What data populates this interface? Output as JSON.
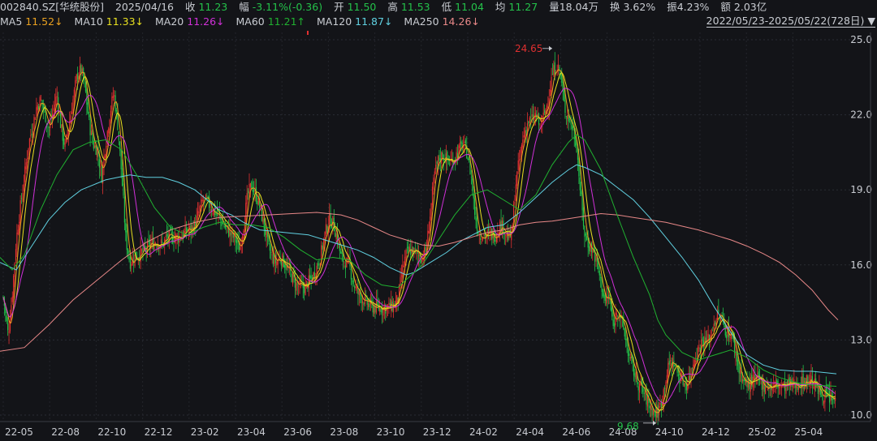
{
  "header": {
    "code": "002840.SZ[华统股份]",
    "date": "2025/04/16",
    "close_label": "收",
    "close": "11.23",
    "chg_label": "幅",
    "chg": "-3.11%(-0.36)",
    "open_label": "开",
    "open": "11.50",
    "high_label": "高",
    "high": "11.53",
    "low_label": "低",
    "low": "11.04",
    "avg_label": "均",
    "avg": "11.27",
    "vol_label": "量",
    "vol": "18.04万",
    "turn_label": "换",
    "turn": "3.62%",
    "amp_label": "振",
    "amp": "4.23%",
    "amt_label": "额",
    "amt": "2.03亿"
  },
  "ma_legend": [
    {
      "name": "MA5",
      "value": "11.52↓",
      "color": "#e8a020"
    },
    {
      "name": "MA10",
      "value": "11.33↓",
      "color": "#e8e020"
    },
    {
      "name": "MA20",
      "value": "11.26↓",
      "color": "#d030d8"
    },
    {
      "name": "MA60",
      "value": "11.21↑",
      "color": "#20b030"
    },
    {
      "name": "MA120",
      "value": "11.87↓",
      "color": "#60d0e0"
    },
    {
      "name": "MA250",
      "value": "14.26↓",
      "color": "#e88888"
    }
  ],
  "range_label": "2022/05/23-2025/05/22(728日)",
  "chart_data": {
    "type": "candlestick",
    "ylim": [
      9.5,
      25.1
    ],
    "y_ticks": [
      "25.0",
      "22.0",
      "19.0",
      "16.0",
      "13.0",
      "10.0"
    ],
    "x_ticks": [
      "22-05",
      "22-08",
      "22-10",
      "22-12",
      "23-02",
      "23-04",
      "23-06",
      "23-08",
      "23-10",
      "23-12",
      "24-02",
      "24-04",
      "24-06",
      "24-08",
      "24-10",
      "24-12",
      "25-02",
      "25-04"
    ],
    "annotations": [
      {
        "label": "24.65",
        "value": 24.65,
        "kind": "high",
        "color": "#e03030"
      },
      {
        "label": "9.68",
        "value": 9.68,
        "kind": "low",
        "color": "#24c24a"
      }
    ],
    "price_path": [
      [
        0,
        15.6
      ],
      [
        5,
        14.5
      ],
      [
        10,
        13.2
      ],
      [
        15,
        14.8
      ],
      [
        20,
        17
      ],
      [
        25,
        18.3
      ],
      [
        30,
        19.5
      ],
      [
        35,
        20.8
      ],
      [
        40,
        21.5
      ],
      [
        45,
        22.3
      ],
      [
        50,
        22.6
      ],
      [
        55,
        22.1
      ],
      [
        60,
        21.4
      ],
      [
        65,
        22.1
      ],
      [
        70,
        22.8
      ],
      [
        75,
        21.5
      ],
      [
        80,
        20.7
      ],
      [
        85,
        21.6
      ],
      [
        90,
        22.6
      ],
      [
        95,
        23.6
      ],
      [
        100,
        23.8
      ],
      [
        105,
        23
      ],
      [
        110,
        21.6
      ],
      [
        115,
        20.8
      ],
      [
        120,
        20.6
      ],
      [
        125,
        19.5
      ],
      [
        130,
        20.8
      ],
      [
        135,
        22
      ],
      [
        140,
        22.9
      ],
      [
        145,
        21.6
      ],
      [
        150,
        19.5
      ],
      [
        155,
        17
      ],
      [
        160,
        16.1
      ],
      [
        165,
        16.3
      ],
      [
        170,
        16.4
      ],
      [
        175,
        16.5
      ],
      [
        180,
        16.6
      ],
      [
        185,
        16.8
      ],
      [
        190,
        16.9
      ],
      [
        195,
        16.9
      ],
      [
        200,
        16.8
      ],
      [
        205,
        17.1
      ],
      [
        210,
        17.1
      ],
      [
        215,
        17.1
      ],
      [
        220,
        17.1
      ],
      [
        225,
        17.2
      ],
      [
        230,
        17.4
      ],
      [
        235,
        17.4
      ],
      [
        240,
        17.6
      ],
      [
        245,
        18.1
      ],
      [
        250,
        18.6
      ],
      [
        255,
        18.5
      ],
      [
        260,
        18.3
      ],
      [
        265,
        18.1
      ],
      [
        270,
        17.9
      ],
      [
        275,
        17.6
      ],
      [
        280,
        17.4
      ],
      [
        285,
        17.2
      ],
      [
        290,
        17
      ],
      [
        295,
        16.6
      ],
      [
        300,
        17.6
      ],
      [
        305,
        18.8
      ],
      [
        310,
        19.2
      ],
      [
        315,
        18.8
      ],
      [
        320,
        18.3
      ],
      [
        325,
        17.6
      ],
      [
        330,
        16.8
      ],
      [
        335,
        16.3
      ],
      [
        340,
        16.1
      ],
      [
        345,
        16.3
      ],
      [
        350,
        16.1
      ],
      [
        355,
        15.8
      ],
      [
        360,
        15.5
      ],
      [
        365,
        15.2
      ],
      [
        370,
        15.1
      ],
      [
        375,
        15.1
      ],
      [
        380,
        15.3
      ],
      [
        385,
        15.5
      ],
      [
        390,
        15.9
      ],
      [
        395,
        16.4
      ],
      [
        400,
        17.2
      ],
      [
        405,
        17.8
      ],
      [
        410,
        17.7
      ],
      [
        415,
        17.1
      ],
      [
        420,
        16.3
      ],
      [
        425,
        16.1
      ],
      [
        430,
        16
      ],
      [
        435,
        15.3
      ],
      [
        440,
        14.9
      ],
      [
        445,
        14.7
      ],
      [
        450,
        14.5
      ],
      [
        455,
        14.4
      ],
      [
        460,
        14.3
      ],
      [
        465,
        14.3
      ],
      [
        470,
        14.3
      ],
      [
        475,
        14.3
      ],
      [
        480,
        14.3
      ],
      [
        485,
        14.4
      ],
      [
        490,
        14.6
      ],
      [
        495,
        15.7
      ],
      [
        500,
        16.4
      ],
      [
        505,
        16.6
      ],
      [
        510,
        16.5
      ],
      [
        515,
        16.4
      ],
      [
        520,
        16.3
      ],
      [
        525,
        16.6
      ],
      [
        530,
        18.1
      ],
      [
        535,
        19.6
      ],
      [
        540,
        20.2
      ],
      [
        545,
        20.4
      ],
      [
        550,
        20.2
      ],
      [
        555,
        20.1
      ],
      [
        560,
        20.3
      ],
      [
        565,
        20.6
      ],
      [
        570,
        20.8
      ],
      [
        575,
        20.5
      ],
      [
        580,
        19.6
      ],
      [
        585,
        18
      ],
      [
        590,
        17.2
      ],
      [
        595,
        17.2
      ],
      [
        600,
        17.2
      ],
      [
        605,
        17.2
      ],
      [
        610,
        17.2
      ],
      [
        615,
        17.6
      ],
      [
        620,
        17.5
      ],
      [
        625,
        17.1
      ],
      [
        630,
        17.2
      ],
      [
        635,
        19.2
      ],
      [
        640,
        20.3
      ],
      [
        645,
        21.2
      ],
      [
        650,
        21.7
      ],
      [
        655,
        21.8
      ],
      [
        660,
        22
      ],
      [
        665,
        21.5
      ],
      [
        670,
        22
      ],
      [
        675,
        22.6
      ],
      [
        680,
        23.6
      ],
      [
        685,
        24
      ],
      [
        690,
        23.7
      ],
      [
        695,
        22.3
      ],
      [
        700,
        21.9
      ],
      [
        705,
        21.5
      ],
      [
        710,
        20.8
      ],
      [
        715,
        18.8
      ],
      [
        720,
        17.2
      ],
      [
        725,
        16.8
      ],
      [
        730,
        16.6
      ],
      [
        735,
        16.1
      ],
      [
        740,
        15.3
      ],
      [
        745,
        14.5
      ],
      [
        750,
        14.8
      ],
      [
        755,
        13.5
      ],
      [
        760,
        14.3
      ],
      [
        765,
        13.8
      ],
      [
        770,
        13.1
      ],
      [
        775,
        12.3
      ],
      [
        780,
        11.8
      ],
      [
        785,
        11.3
      ],
      [
        790,
        11.1
      ],
      [
        795,
        10.7
      ],
      [
        800,
        10.4
      ],
      [
        805,
        10.1
      ],
      [
        810,
        10.1
      ],
      [
        815,
        10.6
      ],
      [
        820,
        11.5
      ],
      [
        825,
        12.1
      ],
      [
        830,
        12.1
      ],
      [
        835,
        11.6
      ],
      [
        840,
        11.4
      ],
      [
        845,
        11.2
      ],
      [
        850,
        11.6
      ],
      [
        855,
        12.3
      ],
      [
        860,
        12.6
      ],
      [
        865,
        13
      ],
      [
        870,
        12.9
      ],
      [
        875,
        13.2
      ],
      [
        880,
        13.8
      ],
      [
        885,
        14
      ],
      [
        890,
        13.7
      ],
      [
        895,
        13.3
      ],
      [
        900,
        13.3
      ],
      [
        905,
        12.6
      ],
      [
        910,
        11.8
      ],
      [
        915,
        11.4
      ],
      [
        920,
        11.2
      ],
      [
        925,
        11.3
      ],
      [
        930,
        11.4
      ],
      [
        935,
        11.4
      ],
      [
        940,
        11.2
      ],
      [
        945,
        11.2
      ],
      [
        950,
        11.1
      ],
      [
        955,
        11.2
      ],
      [
        960,
        11.2
      ],
      [
        965,
        11.1
      ],
      [
        970,
        11.2
      ],
      [
        975,
        11.2
      ],
      [
        980,
        11.2
      ],
      [
        985,
        11.3
      ],
      [
        990,
        11.3
      ],
      [
        995,
        11.4
      ],
      [
        1000,
        11.4
      ],
      [
        1005,
        11.1
      ],
      [
        1010,
        10.9
      ],
      [
        1015,
        10.8
      ],
      [
        1020,
        10.7
      ],
      [
        1025,
        10.6
      ],
      [
        1030,
        10.6
      ]
    ],
    "series": [
      {
        "name": "MA120",
        "color": "#60d0e0",
        "points": [
          [
            0,
            16.1
          ],
          [
            20,
            15.8
          ],
          [
            40,
            16.8
          ],
          [
            60,
            17.8
          ],
          [
            80,
            18.5
          ],
          [
            100,
            19
          ],
          [
            130,
            19.4
          ],
          [
            160,
            19.6
          ],
          [
            180,
            19.5
          ],
          [
            200,
            19.5
          ],
          [
            220,
            19.3
          ],
          [
            240,
            19
          ],
          [
            255,
            18.6
          ],
          [
            270,
            18.2
          ],
          [
            285,
            18
          ],
          [
            300,
            17.7
          ],
          [
            320,
            17.4
          ],
          [
            350,
            17.3
          ],
          [
            380,
            17.2
          ],
          [
            410,
            16.9
          ],
          [
            440,
            16.6
          ],
          [
            460,
            16.3
          ],
          [
            480,
            15.9
          ],
          [
            500,
            15.6
          ],
          [
            510,
            15.7
          ],
          [
            530,
            16.1
          ],
          [
            550,
            16.5
          ],
          [
            570,
            17
          ],
          [
            600,
            17.5
          ],
          [
            620,
            17.6
          ],
          [
            640,
            18.1
          ],
          [
            660,
            18.7
          ],
          [
            680,
            19.3
          ],
          [
            700,
            19.8
          ],
          [
            710,
            20
          ],
          [
            720,
            19.9
          ],
          [
            740,
            19.6
          ],
          [
            760,
            19.1
          ],
          [
            780,
            18.6
          ],
          [
            800,
            17.9
          ],
          [
            820,
            17.1
          ],
          [
            840,
            16.3
          ],
          [
            860,
            15.4
          ],
          [
            880,
            14.3
          ],
          [
            900,
            13.3
          ],
          [
            920,
            12.4
          ],
          [
            940,
            12
          ],
          [
            960,
            11.8
          ],
          [
            980,
            11.75
          ],
          [
            1000,
            11.75
          ],
          [
            1030,
            11.65
          ]
        ]
      },
      {
        "name": "MA250",
        "color": "#e88888",
        "points": [
          [
            0,
            12.55
          ],
          [
            30,
            12.7
          ],
          [
            60,
            13.6
          ],
          [
            90,
            14.6
          ],
          [
            120,
            15.4
          ],
          [
            150,
            16.2
          ],
          [
            180,
            16.9
          ],
          [
            210,
            17.4
          ],
          [
            240,
            17.7
          ],
          [
            270,
            17.9
          ],
          [
            300,
            17.95
          ],
          [
            330,
            18
          ],
          [
            360,
            18.05
          ],
          [
            390,
            18.1
          ],
          [
            420,
            18
          ],
          [
            440,
            17.8
          ],
          [
            460,
            17.5
          ],
          [
            480,
            17.2
          ],
          [
            500,
            17
          ],
          [
            520,
            16.8
          ],
          [
            540,
            16.75
          ],
          [
            560,
            16.9
          ],
          [
            580,
            17.1
          ],
          [
            600,
            17.3
          ],
          [
            620,
            17.4
          ],
          [
            640,
            17.6
          ],
          [
            660,
            17.7
          ],
          [
            680,
            17.75
          ],
          [
            700,
            17.85
          ],
          [
            720,
            17.95
          ],
          [
            740,
            18.05
          ],
          [
            760,
            18
          ],
          [
            780,
            17.9
          ],
          [
            800,
            17.8
          ],
          [
            820,
            17.7
          ],
          [
            840,
            17.55
          ],
          [
            860,
            17.4
          ],
          [
            880,
            17.2
          ],
          [
            900,
            17
          ],
          [
            920,
            16.75
          ],
          [
            940,
            16.45
          ],
          [
            960,
            16.1
          ],
          [
            980,
            15.6
          ],
          [
            1000,
            15
          ],
          [
            1020,
            14.2
          ],
          [
            1032,
            13.8
          ]
        ]
      },
      {
        "name": "MA60",
        "color": "#20b030",
        "points": [
          [
            0,
            16.3
          ],
          [
            15,
            15.8
          ],
          [
            30,
            16.4
          ],
          [
            50,
            18.2
          ],
          [
            70,
            19.6
          ],
          [
            90,
            20.6
          ],
          [
            110,
            20.9
          ],
          [
            130,
            21
          ],
          [
            150,
            20.6
          ],
          [
            170,
            19.5
          ],
          [
            190,
            18.3
          ],
          [
            210,
            17.5
          ],
          [
            230,
            17.2
          ],
          [
            250,
            17.5
          ],
          [
            270,
            17.7
          ],
          [
            290,
            17.6
          ],
          [
            310,
            17.6
          ],
          [
            330,
            17.5
          ],
          [
            350,
            17.1
          ],
          [
            370,
            16.6
          ],
          [
            390,
            16.2
          ],
          [
            410,
            16.3
          ],
          [
            430,
            16.2
          ],
          [
            450,
            15.6
          ],
          [
            470,
            15.2
          ],
          [
            490,
            15.1
          ],
          [
            500,
            15.4
          ],
          [
            520,
            16
          ],
          [
            540,
            17
          ],
          [
            560,
            18
          ],
          [
            580,
            18.8
          ],
          [
            600,
            19
          ],
          [
            620,
            18.6
          ],
          [
            640,
            18.2
          ],
          [
            660,
            18.8
          ],
          [
            680,
            20
          ],
          [
            700,
            20.9
          ],
          [
            710,
            21.2
          ],
          [
            720,
            21
          ],
          [
            740,
            19.8
          ],
          [
            760,
            18
          ],
          [
            780,
            16.3
          ],
          [
            800,
            14.8
          ],
          [
            810,
            13.8
          ],
          [
            820,
            13.2
          ],
          [
            840,
            12.5
          ],
          [
            860,
            12.2
          ],
          [
            880,
            12.4
          ],
          [
            900,
            12.6
          ],
          [
            920,
            12.3
          ],
          [
            940,
            11.8
          ],
          [
            960,
            11.5
          ],
          [
            980,
            11.3
          ],
          [
            1000,
            11.2
          ],
          [
            1030,
            11.15
          ]
        ]
      }
    ]
  }
}
